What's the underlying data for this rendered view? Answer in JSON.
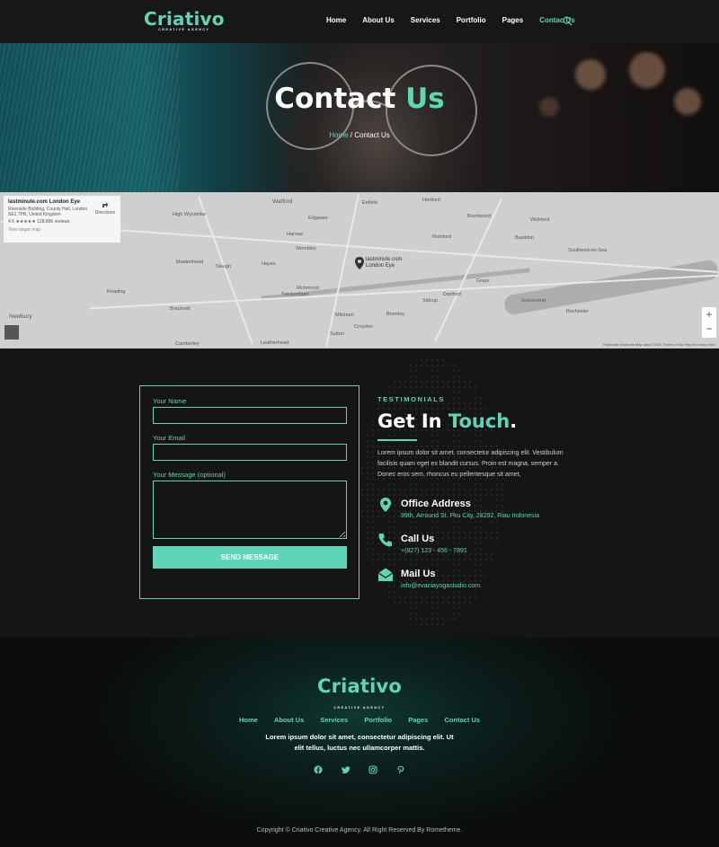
{
  "brand": {
    "name": "Criativo",
    "tagline": "CREATIVE AGENCY",
    "accent": "#5dd6b6"
  },
  "nav": {
    "items": [
      "Home",
      "About Us",
      "Services",
      "Portfolio",
      "Pages",
      "Contac Us"
    ],
    "active_index": 5,
    "search_icon": "search-icon"
  },
  "hero": {
    "title_a": "Contact",
    "title_b": "Us",
    "crumb_home": "Home",
    "crumb_sep": " / ",
    "crumb_current": "Contact Us"
  },
  "map": {
    "card_title": "lastminute.com London Eye",
    "card_address": "Riverside Building, County Hall, London SE1 7PB, United Kingdom",
    "card_rating": "4.5 ★★★★★   128,896 reviews",
    "card_link": "View larger map",
    "directions": "Directions",
    "pin_label": "lastminute.com London Eye",
    "footer": "Keyboard shortcuts   Map data ©2021   Terms of Use   Report a map error",
    "places": [
      "Watford",
      "Enfield",
      "Hertford",
      "Brentwood",
      "Wickford",
      "Southend-on-Sea",
      "High Wycombe",
      "Edgware",
      "Harrow",
      "Romford",
      "Basildon",
      "Maidenhead",
      "Slough",
      "Hayes",
      "Wembley",
      "Grays",
      "Reading",
      "Twickenham",
      "Richmond",
      "Dartford",
      "Bracknell",
      "Mitcham",
      "Bromley",
      "Croydon",
      "Sutton",
      "Newbury",
      "Leatherhead",
      "Sidcup",
      "Gravesend",
      "Rochester",
      "Camberley"
    ]
  },
  "form": {
    "name_label": "Your Name",
    "email_label": "Your Email",
    "message_label": "Your Message (optional)",
    "submit": "SEND MESSAGE"
  },
  "info": {
    "eyebrow": "TESTIMONIALS",
    "heading_a": "Get In",
    "heading_b": "Touch",
    "heading_dot": ".",
    "body": "Lorem ipsum dolor sit amet, consectetur adipiscing elit. Vestibulum facilisis quam eget ex blandit cursus. Proin est magna, semper a. Donec eros sem, rhoncus eu pellentesque sit amet,",
    "items": [
      {
        "icon": "map-pin-icon",
        "title": "Office Address",
        "detail": "99th, Arround St. Pku City, 28292, Riau Indonesia"
      },
      {
        "icon": "phone-icon",
        "title": "Call Us",
        "detail": "+(827) 123 - 456 - 7891"
      },
      {
        "icon": "envelope-icon",
        "title": "Mail Us",
        "detail": "info@evaniayogastudio.com"
      }
    ]
  },
  "footer": {
    "menu": [
      "Home",
      "About Us",
      "Services",
      "Portfolio",
      "Pages",
      "Contact Us"
    ],
    "text": "Lorem ipsum dolor sit amet, consectetur adipiscing elit. Ut elit tellus, luctus nec ullamcorper mattis.",
    "social": [
      "facebook-icon",
      "twitter-icon",
      "instagram-icon",
      "pinterest-icon"
    ],
    "copyright": "Copyright © Criativo Creative Agency. All Right Reserved By Rometheme."
  }
}
